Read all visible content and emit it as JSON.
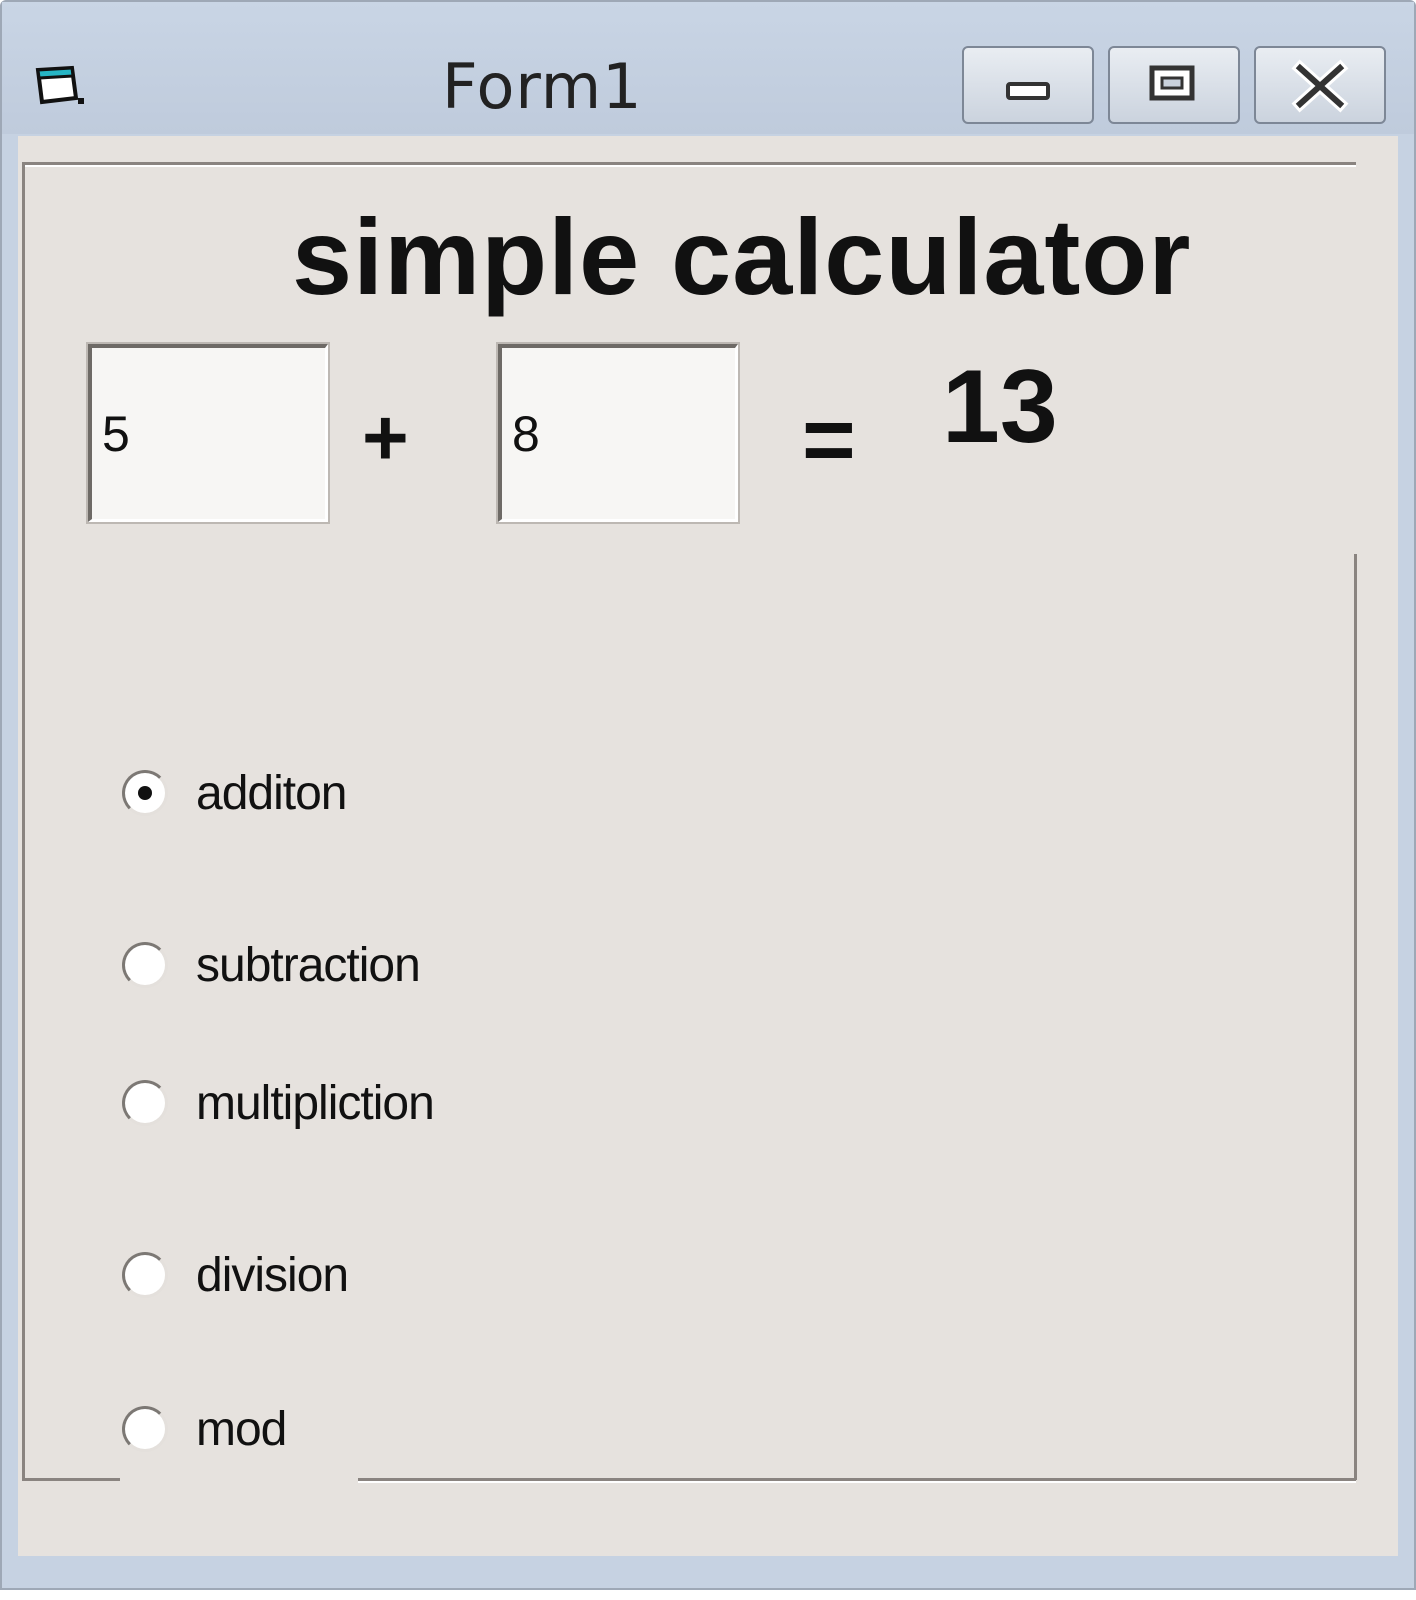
{
  "window": {
    "title": "Form1"
  },
  "form": {
    "heading": "simple calculator",
    "operand1": "5",
    "operand2": "8",
    "operator": "+",
    "equals": "=",
    "result": "13"
  },
  "operations": [
    {
      "label": "additon",
      "selected": true
    },
    {
      "label": "subtraction",
      "selected": false
    },
    {
      "label": "multipliction",
      "selected": false
    },
    {
      "label": "division",
      "selected": false
    },
    {
      "label": "mod",
      "selected": false
    }
  ],
  "icons": {
    "app": "form-icon",
    "minimize": "minimize-icon",
    "maximize": "maximize-icon",
    "close": "close-icon"
  }
}
